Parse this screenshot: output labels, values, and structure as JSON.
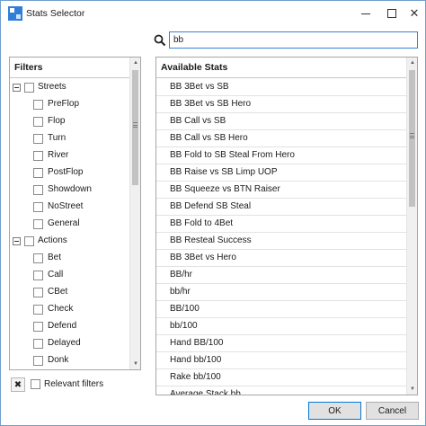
{
  "window": {
    "title": "Stats Selector"
  },
  "search": {
    "value": "bb"
  },
  "filters": {
    "header": "Filters",
    "items": [
      {
        "label": "Streets",
        "level": 0,
        "expander": true
      },
      {
        "label": "PreFlop",
        "level": 1
      },
      {
        "label": "Flop",
        "level": 1
      },
      {
        "label": "Turn",
        "level": 1
      },
      {
        "label": "River",
        "level": 1
      },
      {
        "label": "PostFlop",
        "level": 1
      },
      {
        "label": "Showdown",
        "level": 1
      },
      {
        "label": "NoStreet",
        "level": 1
      },
      {
        "label": "General",
        "level": 1
      },
      {
        "label": "Actions",
        "level": 0,
        "expander": true
      },
      {
        "label": "Bet",
        "level": 1
      },
      {
        "label": "Call",
        "level": 1
      },
      {
        "label": "CBet",
        "level": 1
      },
      {
        "label": "Check",
        "level": 1
      },
      {
        "label": "Defend",
        "level": 1
      },
      {
        "label": "Delayed",
        "level": 1
      },
      {
        "label": "Donk",
        "level": 1
      },
      {
        "label": "",
        "level": 1
      }
    ],
    "relevant_label": "Relevant filters"
  },
  "stats": {
    "header": "Available Stats",
    "items": [
      "BB 3Bet vs SB",
      "BB 3Bet vs SB Hero",
      "BB Call vs SB",
      "BB Call vs SB Hero",
      "BB Fold to SB Steal From Hero",
      "BB Raise vs SB Limp UOP",
      "BB Squeeze vs BTN Raiser",
      "BB Defend SB Steal",
      "BB Fold to 4Bet",
      "BB Resteal Success",
      "BB 3Bet vs Hero",
      "BB/hr",
      "bb/hr",
      "BB/100",
      "bb/100",
      "Hand BB/100",
      "Hand bb/100",
      "Rake bb/100",
      "Average Stack bb"
    ]
  },
  "buttons": {
    "ok": "OK",
    "cancel": "Cancel"
  },
  "colors": {
    "accent": "#0078d7",
    "border": "#6f9fcf"
  }
}
